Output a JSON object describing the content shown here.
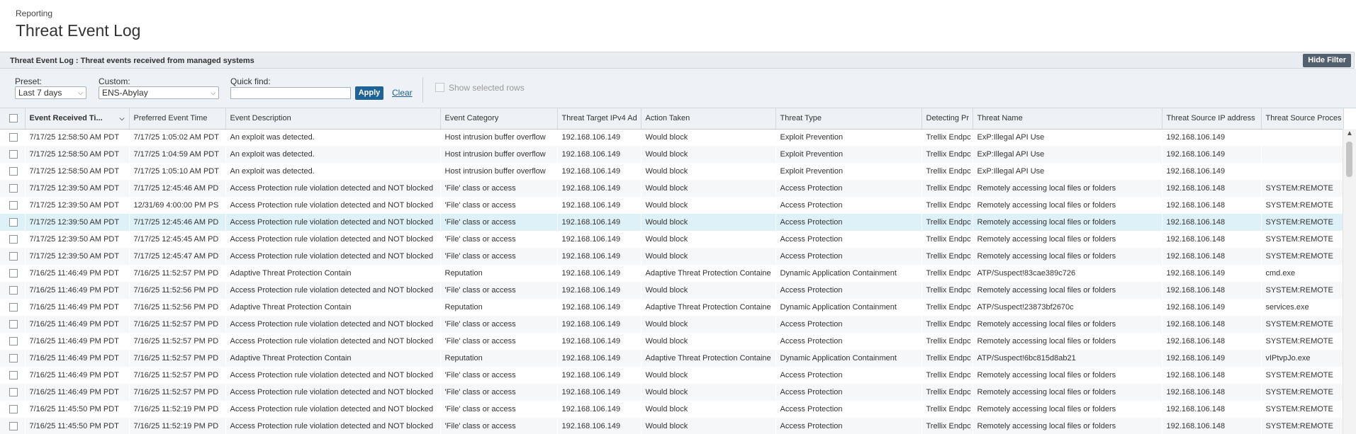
{
  "header": {
    "breadcrumb": "Reporting",
    "title": "Threat Event Log"
  },
  "panel": {
    "title": "Threat Event Log : Threat events received from managed systems",
    "hide_filter_label": "Hide Filter"
  },
  "filter": {
    "preset_label": "Preset:",
    "preset_value": "Last 7 days",
    "custom_label": "Custom:",
    "custom_value": "ENS-Abylay",
    "quickfind_label": "Quick find:",
    "quickfind_value": "",
    "apply_label": "Apply",
    "clear_label": "Clear",
    "show_selected_label": "Show selected rows"
  },
  "table": {
    "columns": [
      "Event Received Ti...",
      "Preferred Event Time",
      "Event Description",
      "Event Category",
      "Threat Target IPv4 Ad",
      "Action Taken",
      "Threat Type",
      "Detecting Pr",
      "Threat Name",
      "Threat Source IP address",
      "Threat Source Proces"
    ],
    "sorted_column": 0,
    "highlight_row": 5,
    "rows": [
      [
        "7/17/25 12:58:50 AM PDT",
        "7/17/25 1:05:02 AM PDT",
        "An exploit was detected.",
        "Host intrusion buffer overflow",
        "192.168.106.149",
        "Would block",
        "Exploit Prevention",
        "Trellix Endpc",
        "ExP:Illegal API Use",
        "192.168.106.149",
        ""
      ],
      [
        "7/17/25 12:58:50 AM PDT",
        "7/17/25 1:04:59 AM PDT",
        "An exploit was detected.",
        "Host intrusion buffer overflow",
        "192.168.106.149",
        "Would block",
        "Exploit Prevention",
        "Trellix Endpc",
        "ExP:Illegal API Use",
        "192.168.106.149",
        ""
      ],
      [
        "7/17/25 12:58:50 AM PDT",
        "7/17/25 1:05:10 AM PDT",
        "An exploit was detected.",
        "Host intrusion buffer overflow",
        "192.168.106.149",
        "Would block",
        "Exploit Prevention",
        "Trellix Endpc",
        "ExP:Illegal API Use",
        "192.168.106.149",
        ""
      ],
      [
        "7/17/25 12:39:50 AM PDT",
        "7/17/25 12:45:46 AM PD",
        "Access Protection rule violation detected and NOT blocked",
        "'File' class or access",
        "192.168.106.149",
        "Would block",
        "Access Protection",
        "Trellix Endpc",
        "Remotely accessing local files or folders",
        "192.168.106.148",
        "SYSTEM:REMOTE"
      ],
      [
        "7/17/25 12:39:50 AM PDT",
        "12/31/69 4:00:00 PM PS",
        "Access Protection rule violation detected and NOT blocked",
        "'File' class or access",
        "192.168.106.149",
        "Would block",
        "Access Protection",
        "Trellix Endpc",
        "Remotely accessing local files or folders",
        "192.168.106.148",
        "SYSTEM:REMOTE"
      ],
      [
        "7/17/25 12:39:50 AM PDT",
        "7/17/25 12:45:46 AM PD",
        "Access Protection rule violation detected and NOT blocked",
        "'File' class or access",
        "192.168.106.149",
        "Would block",
        "Access Protection",
        "Trellix Endpc",
        "Remotely accessing local files or folders",
        "192.168.106.148",
        "SYSTEM:REMOTE"
      ],
      [
        "7/17/25 12:39:50 AM PDT",
        "7/17/25 12:45:45 AM PD",
        "Access Protection rule violation detected and NOT blocked",
        "'File' class or access",
        "192.168.106.149",
        "Would block",
        "Access Protection",
        "Trellix Endpc",
        "Remotely accessing local files or folders",
        "192.168.106.148",
        "SYSTEM:REMOTE"
      ],
      [
        "7/17/25 12:39:50 AM PDT",
        "7/17/25 12:45:47 AM PD",
        "Access Protection rule violation detected and NOT blocked",
        "'File' class or access",
        "192.168.106.149",
        "Would block",
        "Access Protection",
        "Trellix Endpc",
        "Remotely accessing local files or folders",
        "192.168.106.148",
        "SYSTEM:REMOTE"
      ],
      [
        "7/16/25 11:46:49 PM PDT",
        "7/16/25 11:52:57 PM PD",
        "Adaptive Threat Protection Contain",
        "Reputation",
        "192.168.106.149",
        "Adaptive Threat Protection Containe",
        "Dynamic Application Containment",
        "Trellix Endpc",
        "ATP/Suspect!83cae389c726",
        "192.168.106.149",
        "cmd.exe"
      ],
      [
        "7/16/25 11:46:49 PM PDT",
        "7/16/25 11:52:56 PM PD",
        "Access Protection rule violation detected and NOT blocked",
        "'File' class or access",
        "192.168.106.149",
        "Would block",
        "Access Protection",
        "Trellix Endpc",
        "Remotely accessing local files or folders",
        "192.168.106.148",
        "SYSTEM:REMOTE"
      ],
      [
        "7/16/25 11:46:49 PM PDT",
        "7/16/25 11:52:56 PM PD",
        "Adaptive Threat Protection Contain",
        "Reputation",
        "192.168.106.149",
        "Adaptive Threat Protection Containe",
        "Dynamic Application Containment",
        "Trellix Endpc",
        "ATP/Suspect!23873bf2670c",
        "192.168.106.149",
        "services.exe"
      ],
      [
        "7/16/25 11:46:49 PM PDT",
        "7/16/25 11:52:57 PM PD",
        "Access Protection rule violation detected and NOT blocked",
        "'File' class or access",
        "192.168.106.149",
        "Would block",
        "Access Protection",
        "Trellix Endpc",
        "Remotely accessing local files or folders",
        "192.168.106.148",
        "SYSTEM:REMOTE"
      ],
      [
        "7/16/25 11:46:49 PM PDT",
        "7/16/25 11:52:57 PM PD",
        "Access Protection rule violation detected and NOT blocked",
        "'File' class or access",
        "192.168.106.149",
        "Would block",
        "Access Protection",
        "Trellix Endpc",
        "Remotely accessing local files or folders",
        "192.168.106.148",
        "SYSTEM:REMOTE"
      ],
      [
        "7/16/25 11:46:49 PM PDT",
        "7/16/25 11:52:57 PM PD",
        "Adaptive Threat Protection Contain",
        "Reputation",
        "192.168.106.149",
        "Adaptive Threat Protection Containe",
        "Dynamic Application Containment",
        "Trellix Endpc",
        "ATP/Suspect!6bc815d8ab21",
        "192.168.106.149",
        "vIPtvpJo.exe"
      ],
      [
        "7/16/25 11:46:49 PM PDT",
        "7/16/25 11:52:57 PM PD",
        "Access Protection rule violation detected and NOT blocked",
        "'File' class or access",
        "192.168.106.149",
        "Would block",
        "Access Protection",
        "Trellix Endpc",
        "Remotely accessing local files or folders",
        "192.168.106.148",
        "SYSTEM:REMOTE"
      ],
      [
        "7/16/25 11:46:49 PM PDT",
        "7/16/25 11:52:57 PM PD",
        "Access Protection rule violation detected and NOT blocked",
        "'File' class or access",
        "192.168.106.149",
        "Would block",
        "Access Protection",
        "Trellix Endpc",
        "Remotely accessing local files or folders",
        "192.168.106.148",
        "SYSTEM:REMOTE"
      ],
      [
        "7/16/25 11:45:50 PM PDT",
        "7/16/25 11:52:19 PM PD",
        "Access Protection rule violation detected and NOT blocked",
        "'File' class or access",
        "192.168.106.149",
        "Would block",
        "Access Protection",
        "Trellix Endpc",
        "Remotely accessing local files or folders",
        "192.168.106.148",
        "SYSTEM:REMOTE"
      ],
      [
        "7/16/25 11:45:50 PM PDT",
        "7/16/25 11:52:19 PM PD",
        "Access Protection rule violation detected and NOT blocked",
        "'File' class or access",
        "192.168.106.149",
        "Would block",
        "Access Protection",
        "Trellix Endpc",
        "Remotely accessing local files or folders",
        "192.168.106.148",
        "SYSTEM:REMOTE"
      ]
    ]
  },
  "icons": {
    "sort": "chevron-down-icon",
    "dropdown": "chevron-down-icon",
    "scroll_up": "arrow-up-icon"
  },
  "colors": {
    "accent": "#1f6296",
    "highlight_row": "#def0f8",
    "panel_bg": "#e9edf2"
  }
}
